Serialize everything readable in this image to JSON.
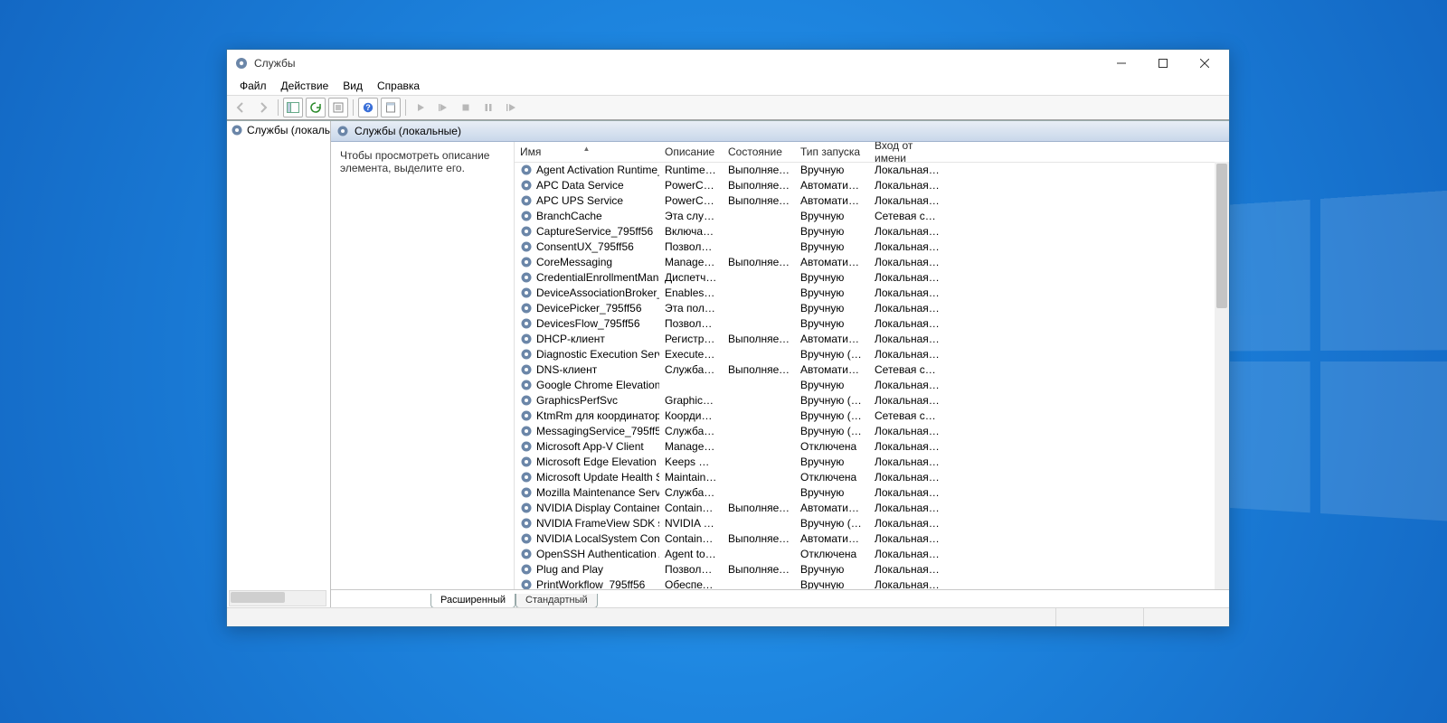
{
  "window": {
    "title": "Службы",
    "menus": [
      "Файл",
      "Действие",
      "Вид",
      "Справка"
    ],
    "nav_label": "Службы (локальн",
    "panel_title": "Службы (локальные)",
    "desc_hint": "Чтобы просмотреть описание элемента, выделите его."
  },
  "columns": {
    "name": "Имя",
    "desc": "Описание",
    "status": "Состояние",
    "startup": "Тип запуска",
    "logon": "Вход от имени"
  },
  "tabs": {
    "ext": "Расширенный",
    "std": "Стандартный"
  },
  "services": [
    {
      "name": "Agent Activation Runtime_...",
      "desc": "Runtime fo...",
      "status": "Выполняется",
      "startup": "Вручную",
      "logon": "Локальная сис..."
    },
    {
      "name": "APC Data Service",
      "desc": "PowerChut...",
      "status": "Выполняется",
      "startup": "Автоматиче...",
      "logon": "Локальная сис..."
    },
    {
      "name": "APC UPS Service",
      "desc": "PowerChut...",
      "status": "Выполняется",
      "startup": "Автоматиче...",
      "logon": "Локальная сис..."
    },
    {
      "name": "BranchCache",
      "desc": "Эта служб...",
      "status": "",
      "startup": "Вручную",
      "logon": "Сетевая служба"
    },
    {
      "name": "CaptureService_795ff56",
      "desc": "Включает ...",
      "status": "",
      "startup": "Вручную",
      "logon": "Локальная сис..."
    },
    {
      "name": "ConsentUX_795ff56",
      "desc": "Позволяет...",
      "status": "",
      "startup": "Вручную",
      "logon": "Локальная сис..."
    },
    {
      "name": "CoreMessaging",
      "desc": "Manages c...",
      "status": "Выполняется",
      "startup": "Автоматиче...",
      "logon": "Локальная слу..."
    },
    {
      "name": "CredentialEnrollmentMana...",
      "desc": "Диспетчер...",
      "status": "",
      "startup": "Вручную",
      "logon": "Локальная сис..."
    },
    {
      "name": "DeviceAssociationBroker_79...",
      "desc": "Enables ap...",
      "status": "",
      "startup": "Вручную",
      "logon": "Локальная сис..."
    },
    {
      "name": "DevicePicker_795ff56",
      "desc": "Эта польз...",
      "status": "",
      "startup": "Вручную",
      "logon": "Локальная сис..."
    },
    {
      "name": "DevicesFlow_795ff56",
      "desc": "Позволяет...",
      "status": "",
      "startup": "Вручную",
      "logon": "Локальная сис..."
    },
    {
      "name": "DHCP-клиент",
      "desc": "Регистрир...",
      "status": "Выполняется",
      "startup": "Автоматиче...",
      "logon": "Локальная слу..."
    },
    {
      "name": "Diagnostic Execution Service",
      "desc": "Executes di...",
      "status": "",
      "startup": "Вручную (ак...",
      "logon": "Локальная сис..."
    },
    {
      "name": "DNS-клиент",
      "desc": "Служба D...",
      "status": "Выполняется",
      "startup": "Автоматиче...",
      "logon": "Сетевая служба"
    },
    {
      "name": "Google Chrome Elevation S...",
      "desc": "",
      "status": "",
      "startup": "Вручную",
      "logon": "Локальная сис..."
    },
    {
      "name": "GraphicsPerfSvc",
      "desc": "Graphics p...",
      "status": "",
      "startup": "Вручную (ак...",
      "logon": "Локальная сис..."
    },
    {
      "name": "KtmRm для координатора ...",
      "desc": "Координи...",
      "status": "",
      "startup": "Вручную (ак...",
      "logon": "Сетевая служба"
    },
    {
      "name": "MessagingService_795ff56",
      "desc": "Служба, о...",
      "status": "",
      "startup": "Вручную (ак...",
      "logon": "Локальная сис..."
    },
    {
      "name": "Microsoft App-V Client",
      "desc": "Manages A...",
      "status": "",
      "startup": "Отключена",
      "logon": "Локальная сис..."
    },
    {
      "name": "Microsoft Edge Elevation Se...",
      "desc": "Keeps Micr...",
      "status": "",
      "startup": "Вручную",
      "logon": "Локальная сис..."
    },
    {
      "name": "Microsoft Update Health Se...",
      "desc": "Maintains ...",
      "status": "",
      "startup": "Отключена",
      "logon": "Локальная сис..."
    },
    {
      "name": "Mozilla Maintenance Service",
      "desc": "Служба п...",
      "status": "",
      "startup": "Вручную",
      "logon": "Локальная сис..."
    },
    {
      "name": "NVIDIA Display Container LS",
      "desc": "Container ...",
      "status": "Выполняется",
      "startup": "Автоматиче...",
      "logon": "Локальная сис..."
    },
    {
      "name": "NVIDIA FrameView SDK serv...",
      "desc": "NVIDIA Fra...",
      "status": "",
      "startup": "Вручную (ак...",
      "logon": "Локальная сис..."
    },
    {
      "name": "NVIDIA LocalSystem Contai...",
      "desc": "Container ...",
      "status": "Выполняется",
      "startup": "Автоматиче...",
      "logon": "Локальная сис..."
    },
    {
      "name": "OpenSSH Authentication A...",
      "desc": "Agent to h...",
      "status": "",
      "startup": "Отключена",
      "logon": "Локальная сис..."
    },
    {
      "name": "Plug and Play",
      "desc": "Позволяет...",
      "status": "Выполняется",
      "startup": "Вручную",
      "logon": "Локальная сис..."
    },
    {
      "name": "PrintWorkflow_795ff56",
      "desc": "Обеспечи...",
      "status": "",
      "startup": "Вручную",
      "logon": "Локальная сис..."
    }
  ]
}
